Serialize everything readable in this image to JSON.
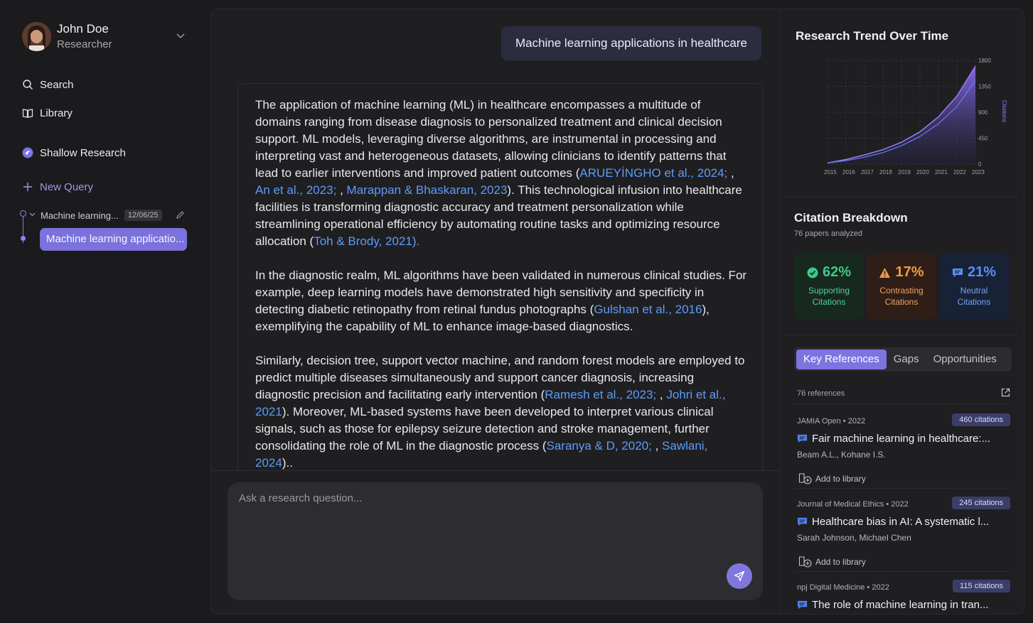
{
  "user": {
    "name": "John Doe",
    "role": "Researcher"
  },
  "nav": {
    "search": "Search",
    "library": "Library",
    "mode": "Shallow Research",
    "new_query": "New Query"
  },
  "history": {
    "parent_label": "Machine learning...",
    "parent_date": "12/06/25",
    "child_label": "Machine learning applicatio..."
  },
  "query": "Machine learning applications in healthcare",
  "answer": {
    "p1_a": "The application of machine learning (ML) in healthcare encompasses a multitude of domains ranging from disease diagnosis to personalized treatment and clinical decision support. ML models, leveraging diverse algorithms, are instrumental in processing and interpreting vast and heterogeneous datasets, allowing clinicians to identify patterns that lead to earlier interventions and improved patient outcomes (",
    "p1_c1": "ARUEYİNGHO et al., 2024;",
    "p1_sep1": " , ",
    "p1_c2": "An et al., 2023;",
    "p1_sep2": " , ",
    "p1_c3": "Marappan & Bhaskaran, 2023",
    "p1_b": "). This technological infusion into healthcare facilities is transforming diagnostic accuracy and treatment personalization while streamlining operational efficiency by automating routine tasks and optimizing resource allocation (",
    "p1_c4": "Toh & Brody, 2021).",
    "p2_a": "In the diagnostic realm, ML algorithms have been validated in numerous clinical studies. For example, deep learning models have demonstrated high sensitivity and specificity in detecting diabetic retinopathy from retinal fundus photographs (",
    "p2_c1": "Gulshan et al., 2016",
    "p2_b": "), exemplifying the capability of ML to enhance image-based diagnostics.",
    "p3_a": "Similarly, decision tree, support vector machine, and random forest models are employed to predict multiple diseases simultaneously and support cancer diagnosis, increasing diagnostic precision and facilitating early intervention (",
    "p3_c1": "Ramesh et al., 2023;",
    "p3_sep1": " , ",
    "p3_c2": "Johri et al., 2021",
    "p3_b": "). Moreover, ML-based systems have been developed to interpret various clinical signals, such as those for epilepsy seizure detection and stroke management, further consolidating the role of ML in the diagnostic process (",
    "p3_c3": "Saranya & D, 2020;",
    "p3_sep2": " , ",
    "p3_c4": "Sawlani, 2024",
    "p3_b2": ").."
  },
  "composer": {
    "placeholder": "Ask a research question..."
  },
  "trend": {
    "title": "Research Trend Over Time"
  },
  "chart_data": {
    "type": "area",
    "title": "Research Trend Over Time",
    "xlabel": "",
    "ylabel": "Citations",
    "x": [
      "2015",
      "2016",
      "2017",
      "2018",
      "2019",
      "2020",
      "2021",
      "2022",
      "2023"
    ],
    "series": [
      {
        "values": [
          20,
          80,
          160,
          250,
          380,
          560,
          820,
          1180,
          1700
        ]
      },
      {
        "values": [
          20,
          60,
          120,
          200,
          320,
          480,
          700,
          1000,
          1450
        ]
      }
    ],
    "ylim": [
      0,
      1800
    ],
    "yticks": [
      "0",
      "450",
      "900",
      "1350",
      "1800"
    ],
    "grid": true,
    "colors": {
      "fill_top": "#8a6cf0",
      "fill_bottom": "#2a2450",
      "line": "#9b7df7",
      "line2": "#5f7ff0"
    }
  },
  "breakdown": {
    "title": "Citation Breakdown",
    "subtitle": "76 papers analyzed",
    "stats": [
      {
        "value": "62%",
        "label1": "Supporting",
        "label2": "Citations",
        "icon": "check-circle-icon",
        "color": "#3ec989"
      },
      {
        "value": "17%",
        "label1": "Contrasting",
        "label2": "Citations",
        "icon": "warning-icon",
        "color": "#f39a43"
      },
      {
        "value": "21%",
        "label1": "Neutral",
        "label2": "Citations",
        "icon": "comment-icon",
        "color": "#5b8ff5"
      }
    ]
  },
  "tabs": [
    "Key References",
    "Gaps",
    "Opportunities"
  ],
  "refs_count": "76 references",
  "add_label": "Add to library",
  "references": [
    {
      "meta": "JAMIA Open • 2022",
      "badge": "460 citations",
      "title": "Fair machine learning in healthcare:...",
      "authors": "Beam A.L., Kohane I.S."
    },
    {
      "meta": "Journal of Medical Ethics • 2022",
      "badge": "245 citations",
      "title": "Healthcare bias in AI: A systematic l...",
      "authors": "Sarah Johnson, Michael Chen"
    },
    {
      "meta": "npj Digital Medicine • 2022",
      "badge": "115 citations",
      "title": "The role of machine learning in tran..."
    }
  ]
}
